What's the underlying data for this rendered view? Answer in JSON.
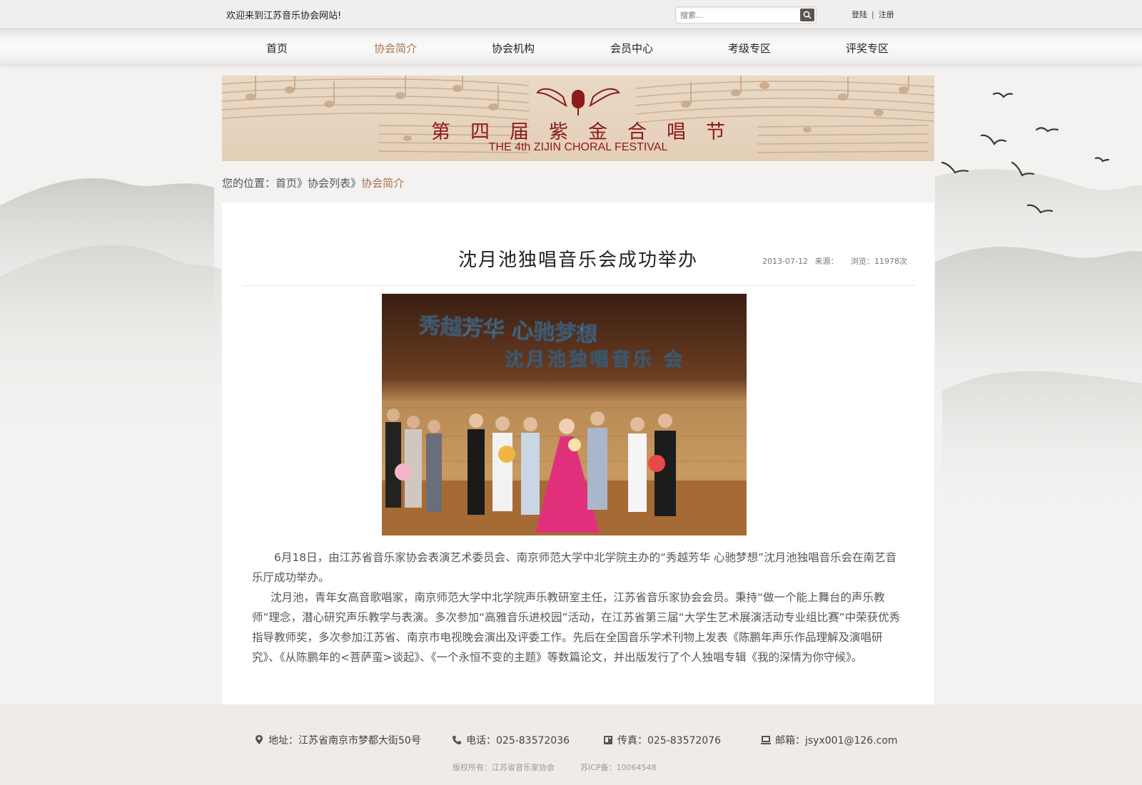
{
  "topbar": {
    "welcome": "欢迎来到江苏音乐协会网站!",
    "search_placeholder": "搜索...",
    "login": "登陆",
    "separator": "|",
    "register": "注册"
  },
  "nav": {
    "items": [
      {
        "label": "首页"
      },
      {
        "label": "协会简介",
        "active": true
      },
      {
        "label": "协会机构"
      },
      {
        "label": "会员中心"
      },
      {
        "label": "考级专区"
      },
      {
        "label": "评奖专区"
      }
    ],
    "active_color": "#a5714d"
  },
  "banner": {
    "title": "第四届紫金合唱节",
    "subtitle": "THE 4th ZIJIN CHORAL FESTIVAL"
  },
  "breadcrumb": {
    "prefix": "您的位置：",
    "home": "首页",
    "sep1": "》",
    "list": "协会列表",
    "sep2": "》",
    "current": "协会简介"
  },
  "article": {
    "title": "沈月池独唱音乐会成功举办",
    "date": "2013-07-12",
    "source": "来源：",
    "views": "浏览：11978次",
    "photo_banner_line1": "秀越芳华 心驰梦想",
    "photo_banner_line2": "沈月池独唱音乐 会",
    "paragraph1": "6月18日，由江苏省音乐家协会表演艺术委员会、南京师范大学中北学院主办的“秀越芳华 心驰梦想”沈月池独唱音乐会在南艺音乐厅成功举办。",
    "paragraph2": "沈月池，青年女高音歌唱家，南京师范大学中北学院声乐教研室主任，江苏省音乐家协会会员。秉持“做一个能上舞台的声乐教师”理念，潜心研究声乐教学与表演。多次参加“高雅音乐进校园”活动，在江苏省第三届“大学生艺术展演活动专业组比赛”中荣获优秀指导教师奖，多次参加江苏省、南京市电视晚会演出及评委工作。先后在全国音乐学术刊物上发表《陈鹏年声乐作品理解及演唱研究》、《从陈鹏年的<菩萨蛮>谈起》、《一个永恒不变的主题》等数篇论文，并出版发行了个人独唱专辑《我的深情为你守候》。"
  },
  "footer": {
    "address": "地址：江苏省南京市梦都大街50号",
    "phone": "电话：025-83572036",
    "fax": "传真：025-83572076",
    "email": "邮箱：jsyx001@126.com",
    "copyright": "版权所有：江苏省音乐家协会",
    "icp": "苏ICP备：10064548",
    "icons": [
      "location-icon",
      "phone-icon",
      "fax-icon",
      "email-icon"
    ]
  }
}
